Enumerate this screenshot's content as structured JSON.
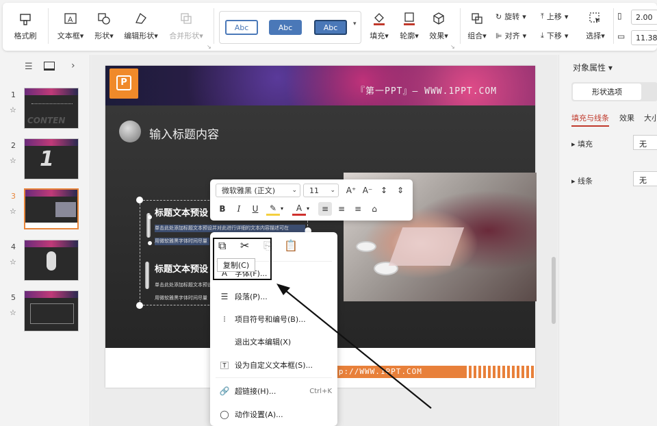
{
  "ribbon": {
    "format_painter": "格式刷",
    "textbox": "文本框",
    "shape": "形状",
    "edit_shape": "编辑形状",
    "merge_shape": "合并形状",
    "style_samples": [
      "Abc",
      "Abc",
      "Abc"
    ],
    "fill": "填充",
    "outline": "轮廓",
    "effect": "效果",
    "group": "组合",
    "rotate": "旋转",
    "align": "对齐",
    "bring_up": "上移",
    "send_down": "下移",
    "select": "选择",
    "height_value": "2.00",
    "width_value": "11.38"
  },
  "slides": {
    "numbers": [
      "1",
      "2",
      "3",
      "4",
      "5"
    ],
    "selected": 3
  },
  "slide": {
    "header_text": "『第一PPT』— WWW.1PPT.COM",
    "title_placeholder": "输入标题内容",
    "sub_title_1": "标题文本预设",
    "sub_title_2": "标题文本预设",
    "body_line_1": "单击此处添加标题文本预设并对此进行详细的文本内容描述可在",
    "body_line_2": "用微软雅黑字体时间尽量",
    "body_line_3": "单击此处添加标题文本预设",
    "body_line_4": "用微软雅黑字体时间尽量",
    "footer_url": "http://WWW.1PPT.COM"
  },
  "mini_toolbar": {
    "font_name": "微软雅黑 (正文)",
    "font_size": "11"
  },
  "context_menu": {
    "tooltip": "复制(C)",
    "font": "字体(F)...",
    "paragraph": "段落(P)...",
    "bullets": "项目符号和编号(B)...",
    "exit_edit": "退出文本编辑(X)",
    "set_default": "设为自定义文本框(S)...",
    "hyperlink": "超链接(H)...",
    "hyperlink_shortcut": "Ctrl+K",
    "action": "动作设置(A)..."
  },
  "right_panel": {
    "title": "对象属性",
    "tab_shape_options": "形状选项",
    "sub_tabs": [
      "填充与线条",
      "效果",
      "大小"
    ],
    "fill_label": "填充",
    "fill_value": "无",
    "line_label": "线条",
    "line_value": "无"
  },
  "colors": {
    "accent_orange": "#e8853a",
    "style_blue": "#4a78b8",
    "slide_dark": "#2b2b2b"
  }
}
